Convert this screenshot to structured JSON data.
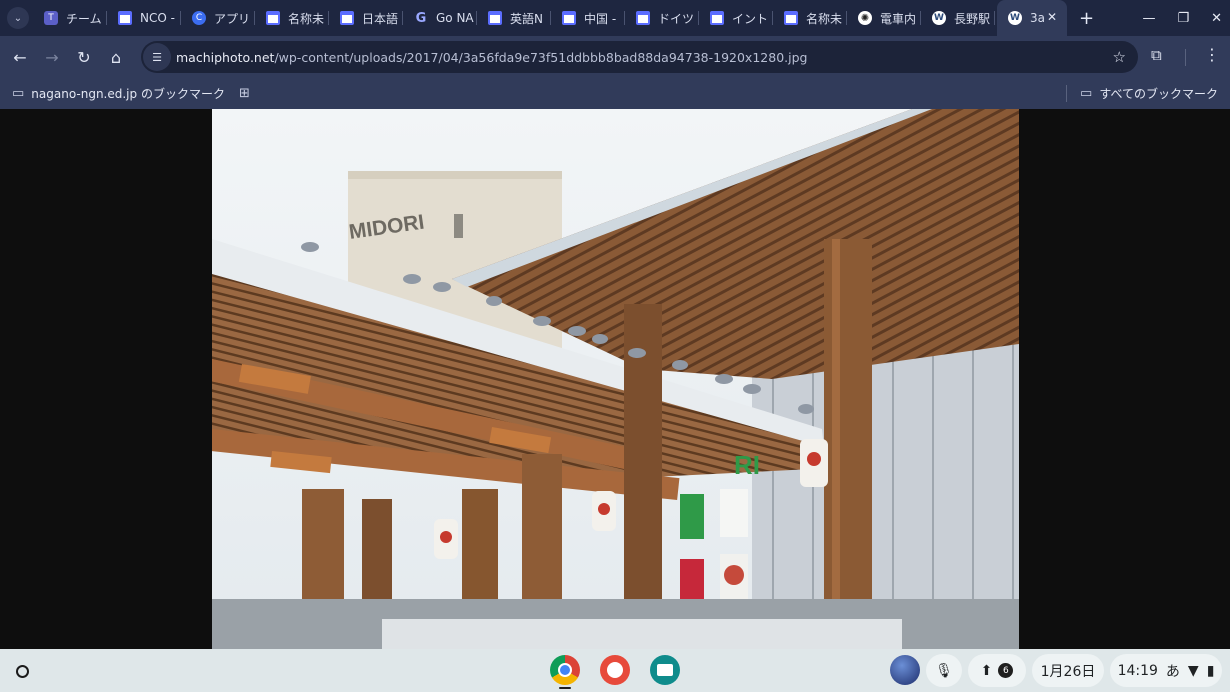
{
  "tabs": [
    {
      "label": "チーム",
      "icon": "teams-icon"
    },
    {
      "label": "NCO -",
      "icon": "page-icon"
    },
    {
      "label": "アプリ",
      "icon": "copilot-icon"
    },
    {
      "label": "名称未",
      "icon": "page-icon"
    },
    {
      "label": "日本語",
      "icon": "page-icon"
    },
    {
      "label": "Go NA",
      "icon": "google-icon"
    },
    {
      "label": "英語N",
      "icon": "page-icon"
    },
    {
      "label": "中国 -",
      "icon": "page-icon"
    },
    {
      "label": "ドイツ",
      "icon": "page-icon"
    },
    {
      "label": "イント",
      "icon": "page-icon"
    },
    {
      "label": "名称未",
      "icon": "page-icon"
    },
    {
      "label": "電車内",
      "icon": "chatgpt-icon"
    },
    {
      "label": "長野駅",
      "icon": "wordpress-icon"
    }
  ],
  "active_tab": {
    "label": "3a",
    "icon": "wordpress-icon"
  },
  "address": {
    "host": "machiphoto.net",
    "path": "/wp-content/uploads/2017/04/3a56fda9e73f51ddbbb8bad88da94738-1920x1280.jpg"
  },
  "bookmarks": {
    "folder": "nagano-ngn.ed.jp のブックマーク",
    "all": "すべてのブックマーク"
  },
  "photo": {
    "sign_building": "MIDORI",
    "sign_front": "RI"
  },
  "shelf": {
    "notification_count": "6",
    "date": "1月26日",
    "time": "14:19",
    "ime": "あ"
  }
}
